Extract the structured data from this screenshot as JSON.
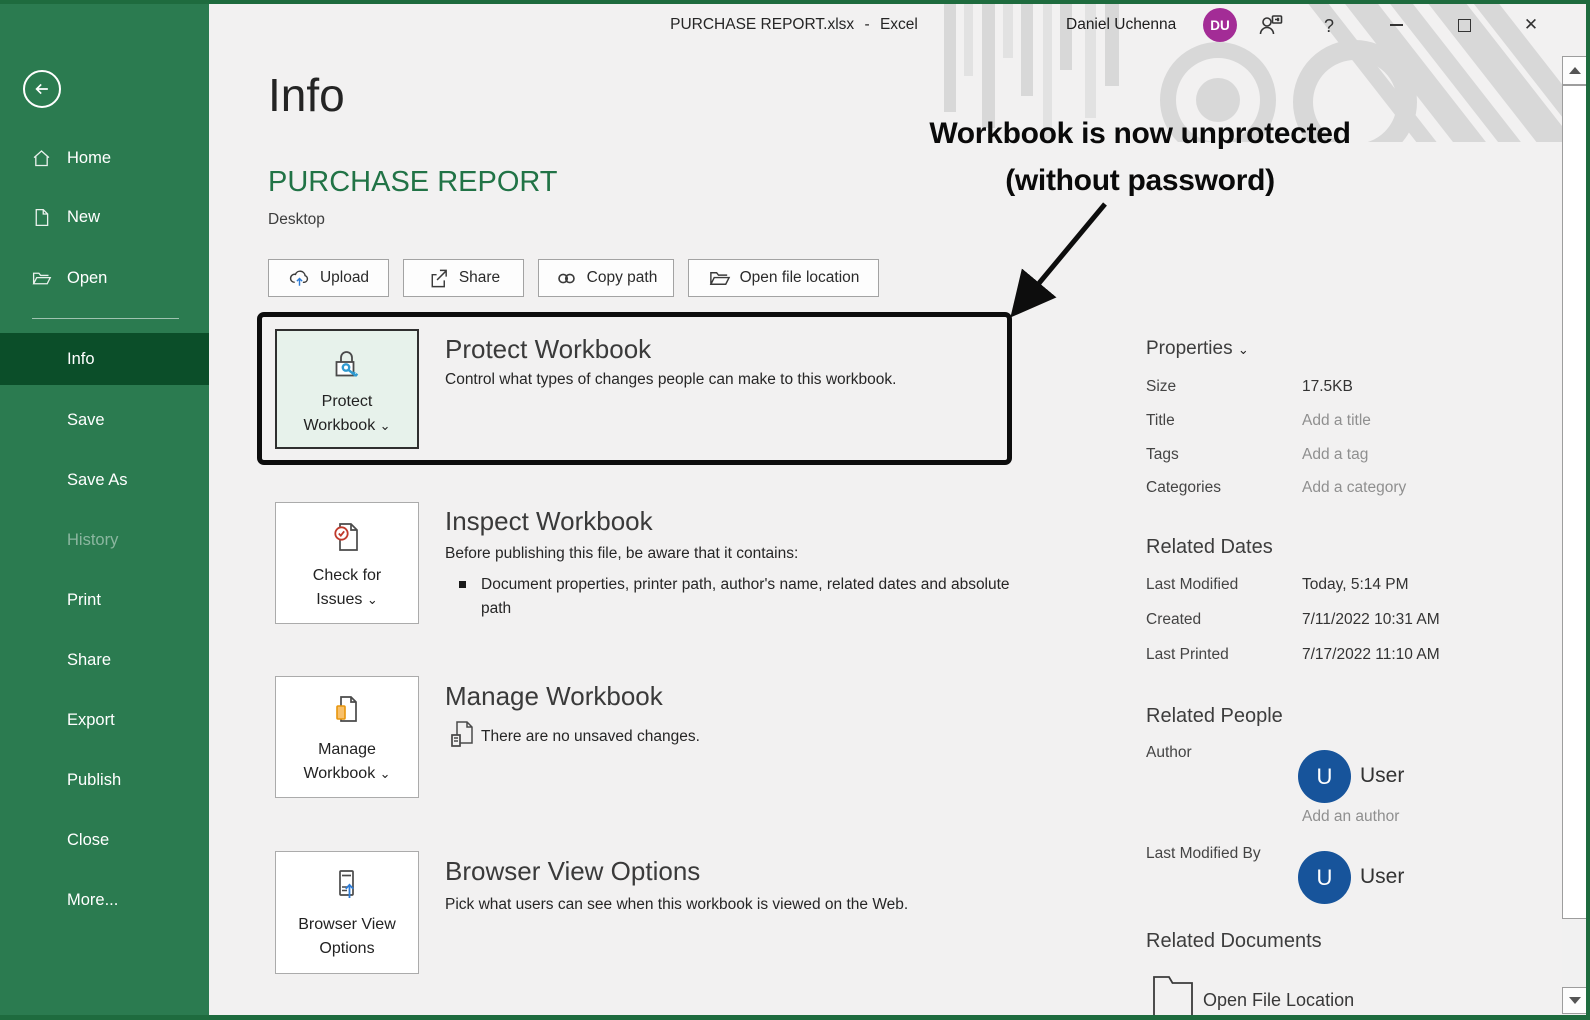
{
  "window": {
    "file_name": "PURCHASE REPORT.xlsx",
    "separator": "-",
    "app_name": "Excel",
    "user_name": "Daniel Uchenna",
    "user_initials": "DU"
  },
  "icons": {
    "chevron_down": "⌄",
    "help": "?",
    "close": "✕"
  },
  "sidebar": {
    "items": [
      {
        "label": "Home"
      },
      {
        "label": "New"
      },
      {
        "label": "Open"
      },
      {
        "label": "Info"
      },
      {
        "label": "Save"
      },
      {
        "label": "Save As"
      },
      {
        "label": "History"
      },
      {
        "label": "Print"
      },
      {
        "label": "Share"
      },
      {
        "label": "Export"
      },
      {
        "label": "Publish"
      },
      {
        "label": "Close"
      },
      {
        "label": "More..."
      }
    ]
  },
  "header": {
    "page_title": "Info",
    "document_title": "PURCHASE REPORT",
    "location": "Desktop"
  },
  "toolbar": {
    "upload": "Upload",
    "share": "Share",
    "copy_path": "Copy path",
    "open_file_location": "Open file location"
  },
  "annotation": {
    "line1": "Workbook is now unprotected",
    "line2": "(without password)"
  },
  "sections": {
    "protect": {
      "button_line1": "Protect",
      "button_line2": "Workbook",
      "title": "Protect Workbook",
      "description": "Control what types of changes people can make to this workbook."
    },
    "inspect": {
      "button_line1": "Check for",
      "button_line2": "Issues",
      "title": "Inspect Workbook",
      "description": "Before publishing this file, be aware that it contains:",
      "bullet": "Document properties, printer path, author's name, related dates and absolute path"
    },
    "manage": {
      "button_line1": "Manage",
      "button_line2": "Workbook",
      "title": "Manage Workbook",
      "status": "There are no unsaved changes."
    },
    "browser": {
      "button_line1": "Browser View",
      "button_line2": "Options",
      "title": "Browser View Options",
      "description": "Pick what users can see when this workbook is viewed on the Web."
    }
  },
  "properties": {
    "title": "Properties",
    "rows": [
      {
        "label": "Size",
        "value": "17.5KB"
      },
      {
        "label": "Title",
        "value": "Add a title"
      },
      {
        "label": "Tags",
        "value": "Add a tag"
      },
      {
        "label": "Categories",
        "value": "Add a category"
      }
    ]
  },
  "related_dates": {
    "title": "Related Dates",
    "rows": [
      {
        "label": "Last Modified",
        "value": "Today, 5:14 PM"
      },
      {
        "label": "Created",
        "value": "7/11/2022 10:31 AM"
      },
      {
        "label": "Last Printed",
        "value": "7/17/2022 11:10 AM"
      }
    ]
  },
  "related_people": {
    "title": "Related People",
    "author_label": "Author",
    "author_initial": "U",
    "author_name": "User",
    "add_author": "Add an author",
    "modified_by_label": "Last Modified By",
    "modified_by_initial": "U",
    "modified_by_name": "User"
  },
  "related_documents": {
    "title": "Related Documents",
    "open_file_location": "Open File Location"
  },
  "colors": {
    "accent_green": "#217346",
    "sidebar_green": "#2b7b50",
    "selected_green": "#0b4e29",
    "avatar_purple": "#a32c96",
    "avatar_blue": "#17549b",
    "highlight_mint": "#e7f2eb",
    "annotation_black": "#0d0d0d"
  }
}
